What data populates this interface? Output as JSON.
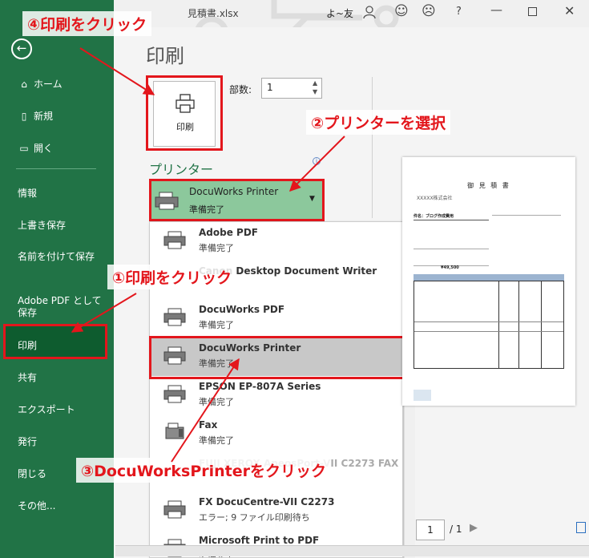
{
  "window": {
    "title": "見積書.xlsx",
    "user": "よ~友"
  },
  "sidebar": {
    "items": [
      {
        "label": "ホーム"
      },
      {
        "label": "新規"
      },
      {
        "label": "開く"
      },
      {
        "label": "情報"
      },
      {
        "label": "上書き保存"
      },
      {
        "label": "名前を付けて保存"
      },
      {
        "label": "Adobe PDF として保存"
      },
      {
        "label": "印刷"
      },
      {
        "label": "共有"
      },
      {
        "label": "エクスポート"
      },
      {
        "label": "発行"
      },
      {
        "label": "閉じる"
      },
      {
        "label": "その他..."
      }
    ]
  },
  "print": {
    "page_title": "印刷",
    "button_label": "印刷",
    "copies_label": "部数:",
    "copies_value": "1",
    "printer_section": "プリンター"
  },
  "selected_printer": {
    "name": "DocuWorks Printer",
    "status": "準備完了"
  },
  "printers": [
    {
      "name": "Adobe PDF",
      "status": "準備完了"
    },
    {
      "name": "Canon Desktop Document Writer",
      "status": ""
    },
    {
      "name": "DocuWorks PDF",
      "status": "準備完了"
    },
    {
      "name": "DocuWorks Printer",
      "status": "準備完了"
    },
    {
      "name": "EPSON EP-807A Series",
      "status": "準備完了"
    },
    {
      "name": "Fax",
      "status": "準備完了"
    },
    {
      "name": "FUJI XEROX ApeosPort-VII C2273 FAX",
      "status": ""
    },
    {
      "name": "FX DocuCentre-VII C2273",
      "status": "エラー; 9 ファイル印刷待ち"
    },
    {
      "name": "Microsoft Print to PDF",
      "status": "準備完了"
    }
  ],
  "annotations": {
    "step1": "①印刷をクリック",
    "step2": "②プリンターを選択",
    "step3": "③DocuWorksPrinterをクリック",
    "step4": "④印刷をクリック"
  },
  "preview": {
    "title": "御 見 積 書",
    "company": "XXXXX株式会社",
    "subject": "件名：ブログ作成費用",
    "total": "¥49,500"
  },
  "page_nav": {
    "current": "1",
    "total": "/ 1"
  },
  "colors": {
    "sidebar": "#217346",
    "active": "#0e5c2f",
    "annotation": "#e3161c",
    "selected_printer_bg": "#8cc89c"
  }
}
